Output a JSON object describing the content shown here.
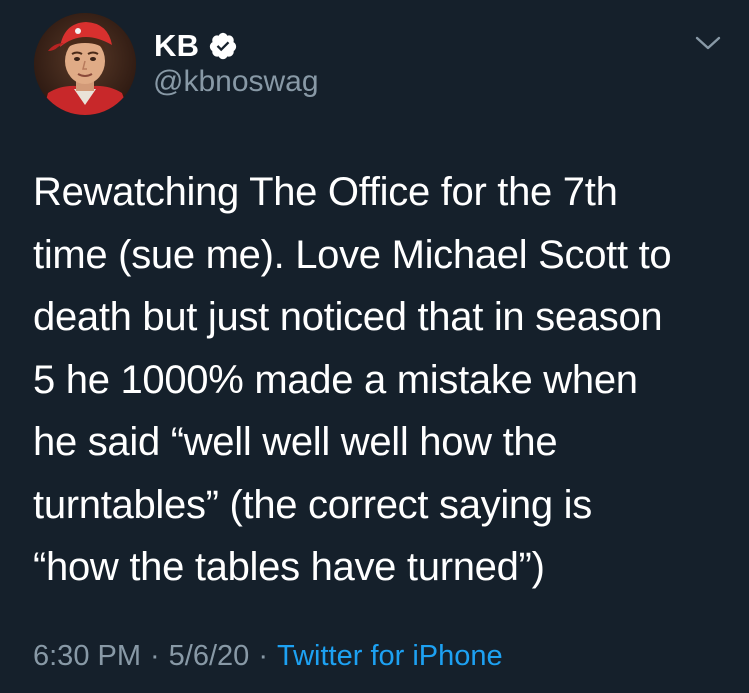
{
  "tweet": {
    "display_name": "KB",
    "handle": "@kbnoswag",
    "verified": true,
    "text": "Rewatching The Office for the 7th\ntime (sue me). Love Michael Scott to\ndeath but just noticed that in season\n5 he 1000% made a mistake when\nhe said “well well well how the\nturntables” (the correct saying is\n“how the tables have turned”)",
    "time": "6:30 PM",
    "separator_1": "·",
    "date": "5/6/20",
    "separator_2": "·",
    "source": "Twitter for iPhone"
  },
  "icons": {
    "verified": "verified-badge-icon",
    "menu": "chevron-down-icon",
    "avatar": "profile-photo"
  },
  "colors": {
    "background": "#15202b",
    "primary_text": "#ffffff",
    "secondary_text": "#8899a6",
    "accent": "#1da1f2"
  }
}
